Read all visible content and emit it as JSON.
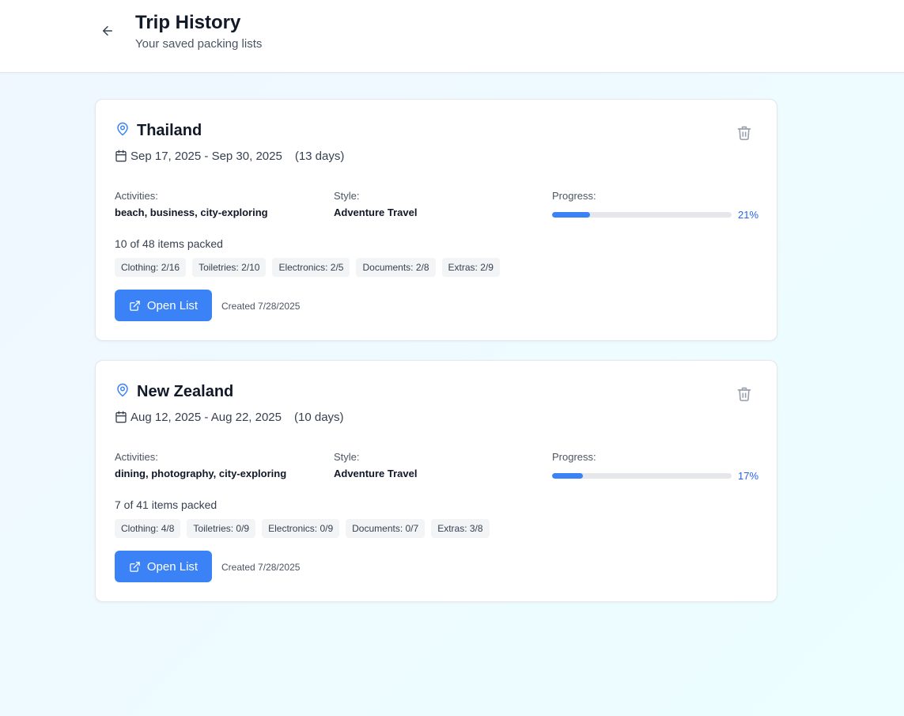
{
  "header": {
    "title": "Trip History",
    "subtitle": "Your saved packing lists"
  },
  "labels": {
    "activities": "Activities:",
    "style": "Style:",
    "progress": "Progress:",
    "open_list": "Open List"
  },
  "icons": {
    "back": "arrow-left-icon",
    "location": "map-pin-icon",
    "calendar": "calendar-icon",
    "delete": "trash-icon",
    "open": "external-link-icon"
  },
  "colors": {
    "accent": "#3b82f6",
    "accent_text": "#2563eb",
    "track": "#e5e7eb"
  },
  "trips": [
    {
      "destination": "Thailand",
      "date_range": "Sep 17, 2025 - Sep 30, 2025",
      "duration": "(13 days)",
      "activities": "beach, business, city-exploring",
      "style": "Adventure Travel",
      "progress_value": 0.21,
      "progress_text": "21%",
      "packed_text": "10 of 48 items packed",
      "categories": [
        "Clothing: 2/16",
        "Toiletries: 2/10",
        "Electronics: 2/5",
        "Documents: 2/8",
        "Extras: 2/9"
      ],
      "created": "Created 7/28/2025"
    },
    {
      "destination": "New Zealand",
      "date_range": "Aug 12, 2025 - Aug 22, 2025",
      "duration": "(10 days)",
      "activities": "dining, photography, city-exploring",
      "style": "Adventure Travel",
      "progress_value": 0.17,
      "progress_text": "17%",
      "packed_text": "7 of 41 items packed",
      "categories": [
        "Clothing: 4/8",
        "Toiletries: 0/9",
        "Electronics: 0/9",
        "Documents: 0/7",
        "Extras: 3/8"
      ],
      "created": "Created 7/28/2025"
    }
  ]
}
